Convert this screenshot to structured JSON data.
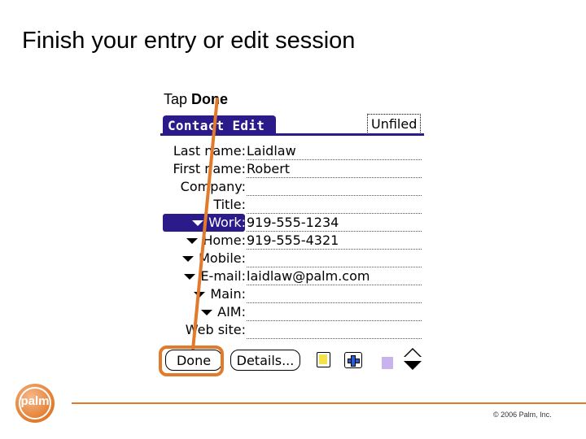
{
  "slide": {
    "title": "Finish your entry or edit session",
    "hint_prefix": "Tap ",
    "hint_bold": "Done",
    "copyright": "© 2006 Palm, Inc.",
    "logo_text": "palm"
  },
  "device": {
    "form_title": "Contact Edit",
    "category": "Unfiled",
    "fields": [
      {
        "label": "Last name:",
        "value": "Laidlaw",
        "dropdown": false,
        "selected": false
      },
      {
        "label": "First name:",
        "value": "Robert",
        "dropdown": false,
        "selected": false
      },
      {
        "label": "Company:",
        "value": "",
        "dropdown": false,
        "selected": false
      },
      {
        "label": "Title:",
        "value": "",
        "dropdown": false,
        "selected": false
      },
      {
        "label": "Work:",
        "value": "919-555-1234",
        "dropdown": true,
        "selected": true
      },
      {
        "label": "Home:",
        "value": "919-555-4321",
        "dropdown": true,
        "selected": false
      },
      {
        "label": "Mobile:",
        "value": "",
        "dropdown": true,
        "selected": false
      },
      {
        "label": "E-mail:",
        "value": "laidlaw@palm.com",
        "dropdown": true,
        "selected": false
      },
      {
        "label": "Main:",
        "value": "",
        "dropdown": true,
        "selected": false
      },
      {
        "label": "AIM:",
        "value": "",
        "dropdown": true,
        "selected": false
      },
      {
        "label": "Web site:",
        "value": "",
        "dropdown": false,
        "selected": false
      }
    ],
    "buttons": {
      "done": "Done",
      "details": "Details..."
    },
    "icons": {
      "note": "note-icon",
      "new": "plus-icon",
      "scroll": "scroll-arrows-icon"
    }
  },
  "colors": {
    "accent": "#e27a2b",
    "palm_blue": "#2b1a8a"
  }
}
